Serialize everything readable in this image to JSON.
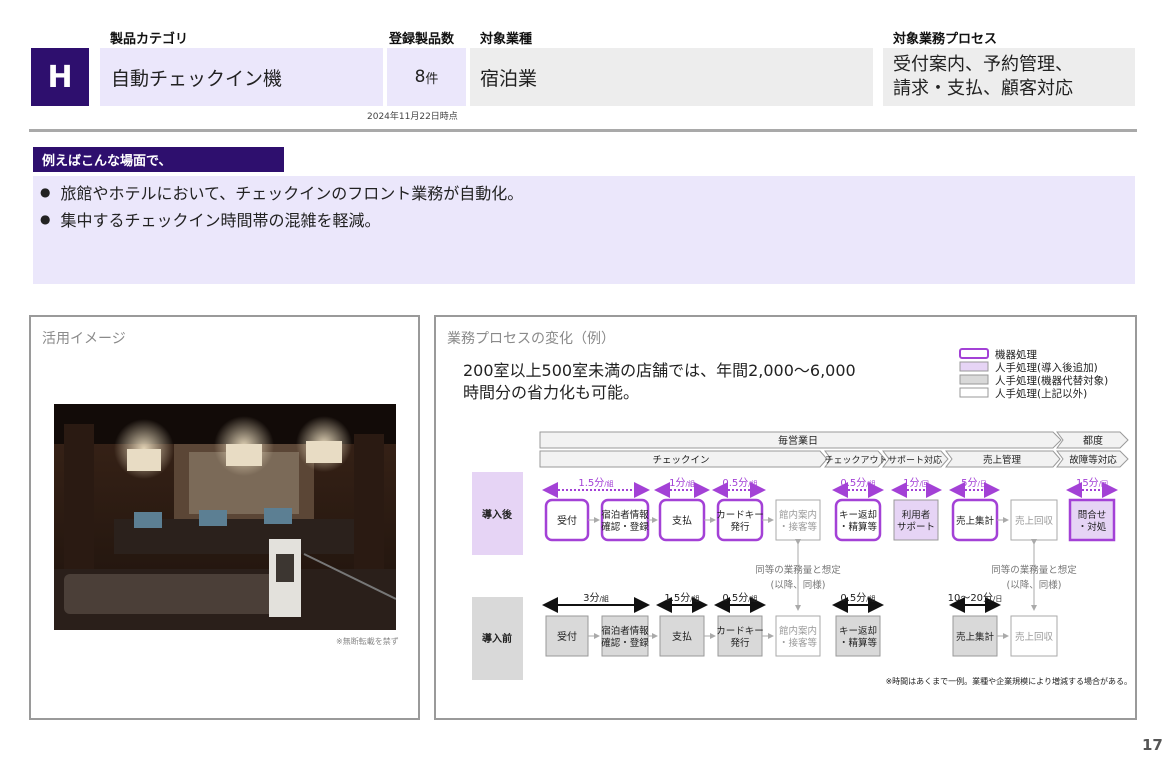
{
  "header": {
    "category_label": "製品カテゴリ",
    "count_label": "登録製品数",
    "industry_label": "対象業種",
    "process_label": "対象業務プロセス",
    "letter": "H",
    "category_value": "自動チェックイン機",
    "count_value": "8",
    "count_unit": "件",
    "industry_value": "宿泊業",
    "process_value_line1": "受付案内、予約管理、",
    "process_value_line2": "請求・支払、顧客対応",
    "as_of": "2024年11月22日時点"
  },
  "scene": {
    "tag": "例えばこんな場面で、",
    "bullets": [
      "旅館やホテルにおいて、チェックインのフロント業務が自動化。",
      "集中するチェックイン時間帯の混雑を軽減。"
    ]
  },
  "image_panel": {
    "title": "活用イメージ",
    "note": "※無断転載を禁ず"
  },
  "process_panel": {
    "title": "業務プロセスの変化（例）",
    "summary_line1": "200室以上500室未満の店舗では、年間2,000～6,000",
    "summary_line2": "時間分の省力化も可能。",
    "legend": [
      "機器処理",
      "人手処理(導入後追加)",
      "人手処理(機器代替対象)",
      "人手処理(上記以外)"
    ],
    "phase_daily": "毎営業日",
    "phase_each": "都度",
    "stages": [
      "チェックイン",
      "チェックアウト",
      "サポート対応",
      "売上管理",
      "故障等対応"
    ],
    "row_after": "導入後",
    "row_before": "導入前",
    "after_steps": [
      "受付",
      "宿泊者情報",
      "確認・登録",
      "支払",
      "カードキー",
      "発行",
      "館内案内",
      "・接客等",
      "キー返却",
      "・精算等",
      "利用者",
      "サポート",
      "売上集計",
      "売上回収",
      "問合せ",
      "・対処"
    ],
    "after_times": [
      "1.5分",
      "1分",
      "0.5分",
      "0.5分",
      "1分",
      "5分",
      "15分"
    ],
    "after_units": [
      "/組",
      "/組",
      "/組",
      "/組",
      "/回",
      "/日",
      "/回"
    ],
    "before_steps": [
      "受付",
      "宿泊者情報",
      "確認・登録",
      "支払",
      "カードキー",
      "発行",
      "館内案内",
      "・接客等",
      "キー返却",
      "・精算等",
      "売上集計",
      "売上回収"
    ],
    "before_times": [
      "3分",
      "1.5分",
      "0.5分",
      "0.5分",
      "10～20分"
    ],
    "before_units": [
      "/組",
      "/組",
      "/組",
      "/組",
      "/日"
    ],
    "same_note_1a": "同等の業務量と想定",
    "same_note_1b": "(以降、同様)",
    "same_note_2a": "同等の業務量と想定",
    "same_note_2b": "(以降、同様)",
    "footnote": "※時間はあくまで一例。業種や企業規模により増減する場合がある。"
  },
  "page_number": "17",
  "colors": {
    "brand_purple": "#2e0f6e",
    "device_border": "#a341d6",
    "device_fill": "#e6d4f5",
    "replaced_fill": "#d9d9d9",
    "lavender": "#ebe7fb"
  }
}
